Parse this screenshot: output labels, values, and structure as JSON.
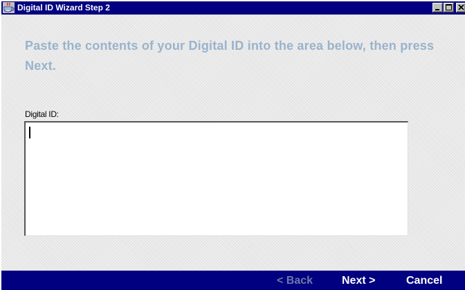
{
  "window": {
    "title": "Digital ID Wizard Step 2",
    "controls": {
      "minimize": "minimize-icon",
      "maximize": "maximize-icon",
      "close": "close-icon"
    }
  },
  "main": {
    "instruction": "Paste the contents of your Digital ID into the area below, then press Next.",
    "field": {
      "label": "Digital ID:",
      "value": ""
    }
  },
  "footer": {
    "back_label": "< Back",
    "back_enabled": false,
    "next_label": "Next >",
    "cancel_label": "Cancel"
  },
  "colors": {
    "title_bar": "#000080",
    "instruction_text": "#99b3cc",
    "disabled_button_text": "#6a7aa8",
    "button_text": "#ffffff"
  }
}
